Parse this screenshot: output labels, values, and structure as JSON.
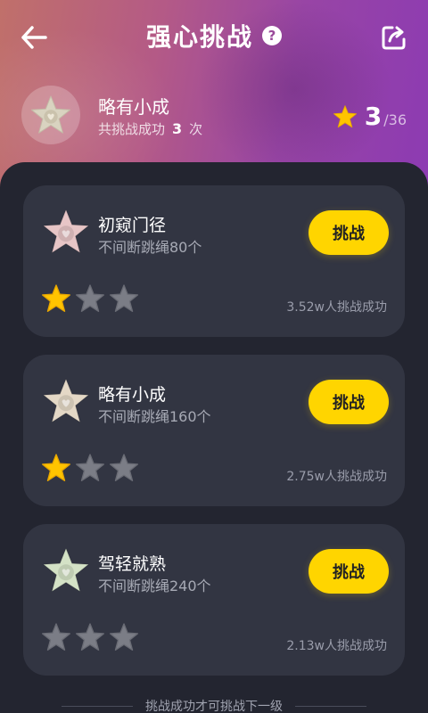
{
  "header": {
    "title": "强心挑战",
    "help_symbol": "?"
  },
  "profile": {
    "level_name": "略有小成",
    "success_label": "共挑战成功",
    "success_count": "3",
    "success_unit": "次",
    "stars_earned": "3",
    "stars_total": "/36"
  },
  "challenges": [
    {
      "title": "初窥门径",
      "desc": "不间断跳绳80个",
      "button": "挑战",
      "success_text": "3.52w人挑战成功",
      "stars_filled": 1,
      "stars_max": 3,
      "badge_color": "#e7c5c6"
    },
    {
      "title": "略有小成",
      "desc": "不间断跳绳160个",
      "button": "挑战",
      "success_text": "2.75w人挑战成功",
      "stars_filled": 1,
      "stars_max": 3,
      "badge_color": "#e4d8c6"
    },
    {
      "title": "驾轻就熟",
      "desc": "不间断跳绳240个",
      "button": "挑战",
      "success_text": "2.13w人挑战成功",
      "stars_filled": 0,
      "stars_max": 3,
      "badge_color": "#d4e2c6"
    }
  ],
  "footer": {
    "note": "挑战成功才可挑战下一级"
  },
  "icons": {
    "back": "back-arrow-icon",
    "share": "share-icon",
    "help": "help-icon",
    "star": "star-icon",
    "badge": "star-badge-icon"
  },
  "colors": {
    "accent": "#ffd500",
    "star_filled": "#ffc400",
    "star_empty": "#7b7d86",
    "card_bg": "#323542",
    "page_bg": "#232530"
  }
}
